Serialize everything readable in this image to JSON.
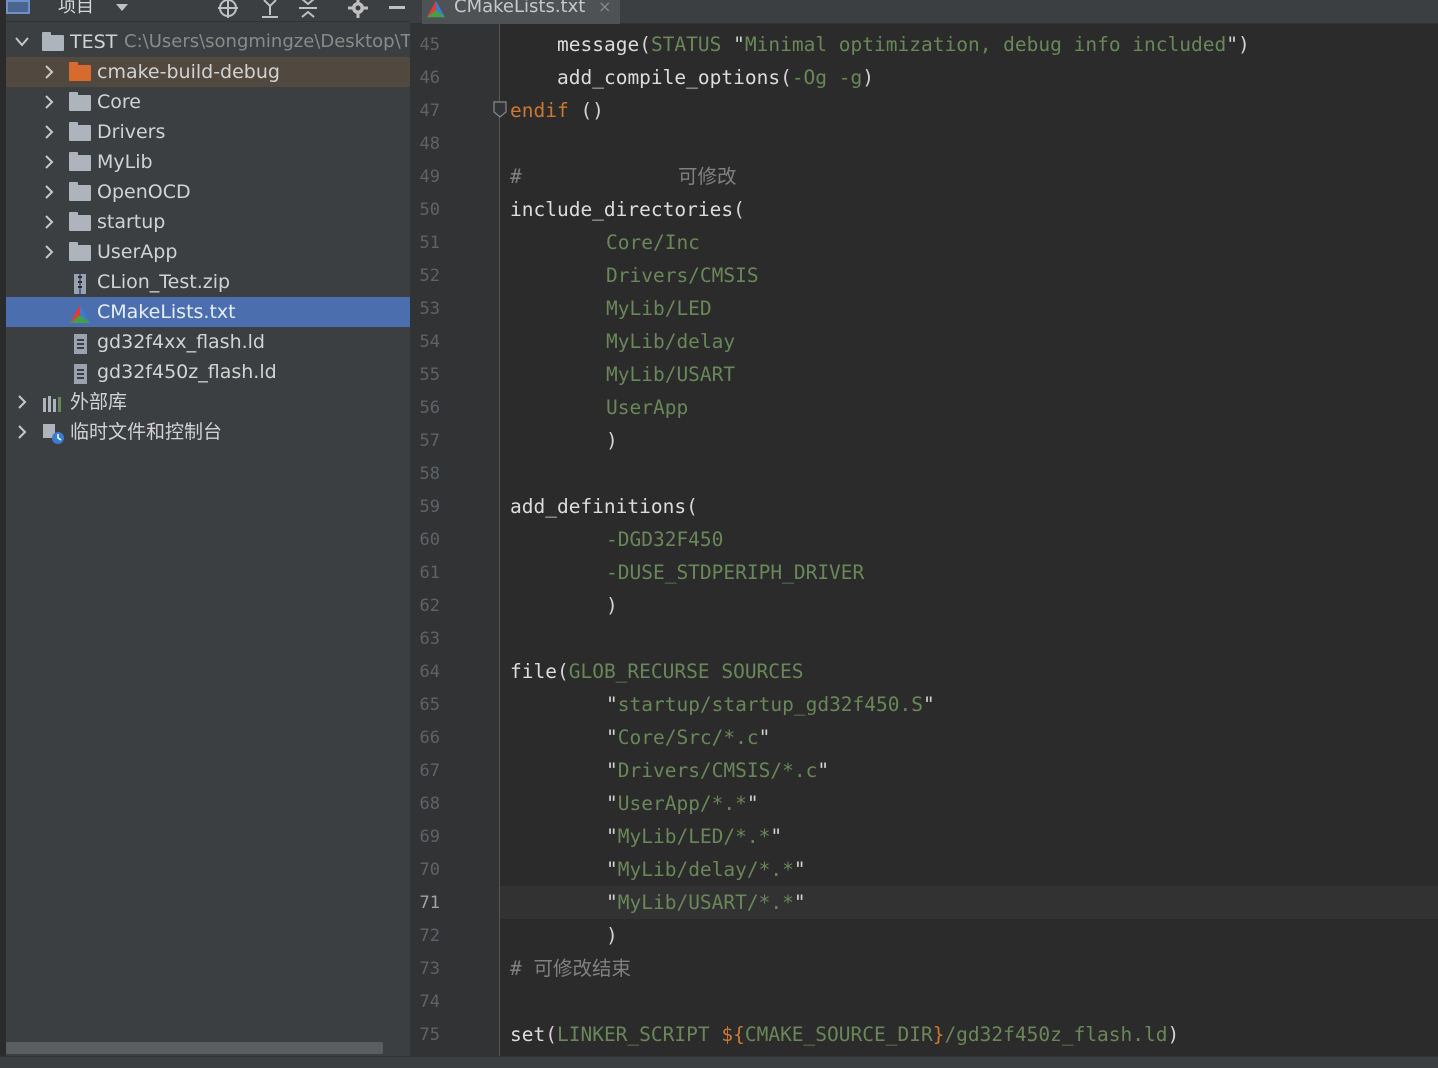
{
  "panel": {
    "title": "项目"
  },
  "tree": {
    "root": {
      "label": "TEST",
      "path": "C:\\Users\\songmingze\\Desktop\\TE"
    },
    "items": [
      {
        "label": "cmake-build-debug"
      },
      {
        "label": "Core"
      },
      {
        "label": "Drivers"
      },
      {
        "label": "MyLib"
      },
      {
        "label": "OpenOCD"
      },
      {
        "label": "startup"
      },
      {
        "label": "UserApp"
      },
      {
        "label": "CLion_Test.zip"
      },
      {
        "label": "CMakeLists.txt"
      },
      {
        "label": "gd32f4xx_flash.ld"
      },
      {
        "label": "gd32f450z_flash.ld"
      }
    ],
    "external_libs": "外部库",
    "scratches": "临时文件和控制台"
  },
  "editor": {
    "tab_label": "CMakeLists.txt",
    "tab_close": "×",
    "current_line": "71",
    "line_numbers": [
      "45",
      "46",
      "47",
      "48",
      "49",
      "50",
      "51",
      "52",
      "53",
      "54",
      "55",
      "56",
      "57",
      "58",
      "59",
      "60",
      "61",
      "62",
      "63",
      "64",
      "65",
      "66",
      "67",
      "68",
      "69",
      "70",
      "71",
      "72",
      "73",
      "74",
      "75"
    ],
    "code": {
      "l45": {
        "fn": "message",
        "open": "(",
        "arg": "STATUS",
        "q1": "\"",
        "str": "Minimal optimization, debug info included",
        "q2": "\"",
        "close": ")"
      },
      "l46": {
        "fn": "add_compile_options",
        "open": "(",
        "arg": "-Og -g",
        "close": ")"
      },
      "l47": {
        "kw": "endif",
        "rest": " ()"
      },
      "l49": {
        "hash": "#",
        "comment": "可修改"
      },
      "l50": {
        "fn": "include_directories",
        "open": "("
      },
      "include_dirs": [
        "Core/Inc",
        "Drivers/CMSIS",
        "MyLib/LED",
        "MyLib/delay",
        "MyLib/USART",
        "UserApp"
      ],
      "l57": ")",
      "l59": {
        "fn": "add_definitions",
        "open": "("
      },
      "definitions": [
        "-DGD32F450",
        "-DUSE_STDPERIPH_DRIVER"
      ],
      "l62": ")",
      "l64": {
        "fn": "file",
        "open": "(",
        "arg": "GLOB_RECURSE SOURCES"
      },
      "sources": [
        "startup/startup_gd32f450.S",
        "Core/Src/*.c",
        "Drivers/CMSIS/*.c",
        "UserApp/*.*",
        "MyLib/LED/*.*",
        "MyLib/delay/*.*",
        "MyLib/USART/*.*"
      ],
      "quote": "\"",
      "l72": ")",
      "l73": "# 可修改结束",
      "l75": {
        "fn": "set",
        "open": "(",
        "arg": "LINKER_SCRIPT ",
        "var_open": "${",
        "var": "CMAKE_SOURCE_DIR",
        "var_close": "}",
        "path": "/gd32f450z_flash.ld",
        "close": ")"
      }
    }
  },
  "colors": {
    "background": "#2b2b2b",
    "panel": "#3c3f41",
    "selection": "#4b6eaf",
    "keyword": "#cc7832",
    "string": "#6a8759",
    "comment": "#808080"
  },
  "icons": [
    "project-icon",
    "chevron-down-icon",
    "locate-target-icon",
    "expand-all-icon",
    "collapse-all-icon",
    "gear-icon",
    "minimize-icon",
    "folder-icon",
    "zip-file-icon",
    "cmake-icon",
    "text-file-icon",
    "library-icon",
    "scratches-icon",
    "fold-marker-icon"
  ]
}
